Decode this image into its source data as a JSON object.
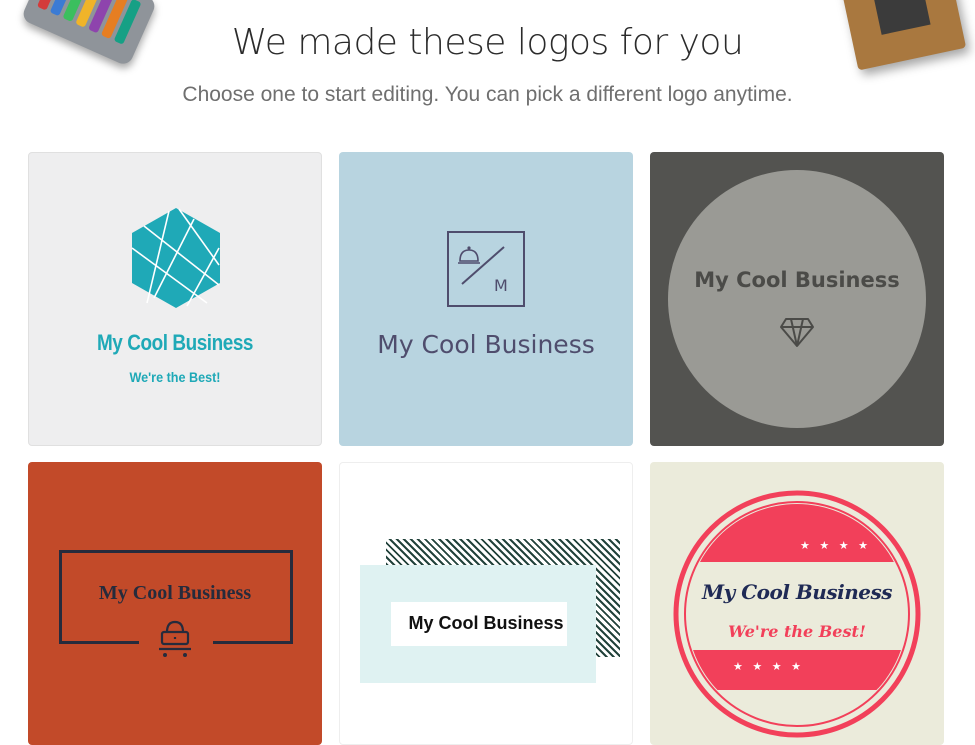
{
  "header": {
    "title": "We made these logos for you",
    "subtitle": "Choose one to start editing. You can pick a different logo anytime."
  },
  "logos": [
    {
      "name": "My Cool Business",
      "tagline": "We're the Best!",
      "background": "#eeeeef",
      "accent": "#1fa9b7",
      "icon": "geometric-hexagon-icon"
    },
    {
      "name": "My Cool Business",
      "monogram": "M",
      "background": "#b8d4e0",
      "accent": "#4f4d6d",
      "icon": "bell-icon"
    },
    {
      "name": "My Cool Business",
      "background": "#535350",
      "accent": "#4b4b48",
      "icon": "diamond-icon"
    },
    {
      "name": "My Cool Business",
      "background": "#c24a29",
      "accent": "#262b3c",
      "icon": "bag-icon"
    },
    {
      "name": "My Cool Business",
      "background": "#ffffff",
      "accent": "#23433c",
      "icon": "none"
    },
    {
      "name": "My Cool Business",
      "tagline": "We're the Best!",
      "stars": "★ ★ ★ ★",
      "background": "#ebebdb",
      "accent": "#f2405a",
      "icon": "stars-icon"
    }
  ]
}
